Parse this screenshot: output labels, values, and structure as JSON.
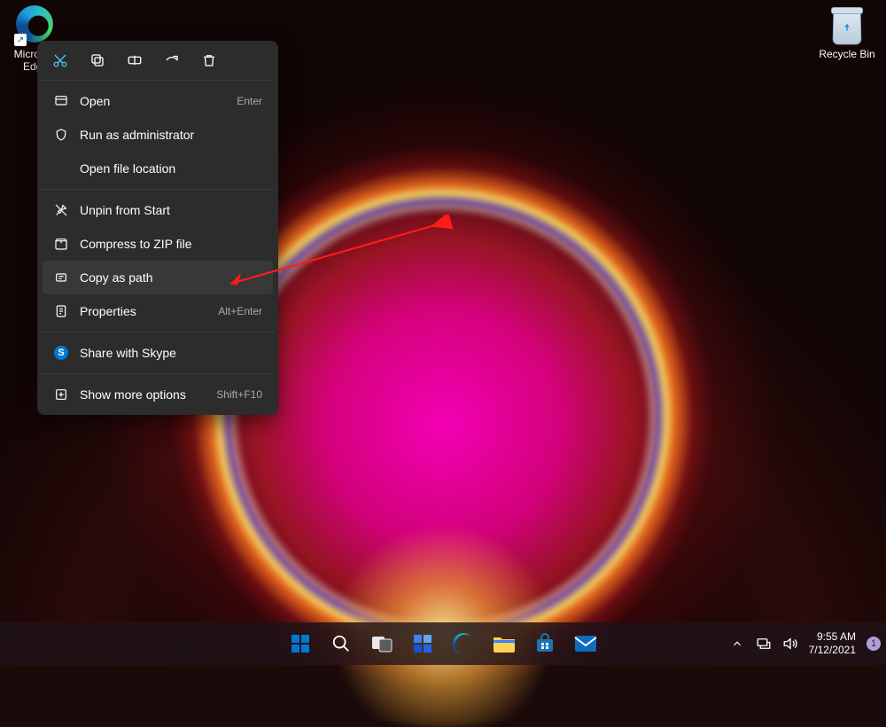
{
  "desktop": {
    "icons": {
      "edge_label": "Microsoft Edge",
      "recycle_label": "Recycle Bin"
    }
  },
  "context_menu": {
    "toolbar_icons": [
      "cut",
      "copy",
      "rename",
      "share",
      "delete"
    ],
    "items": [
      {
        "icon": "open",
        "label": "Open",
        "accel": "Enter"
      },
      {
        "icon": "shield",
        "label": "Run as administrator",
        "accel": ""
      },
      {
        "icon": "",
        "label": "Open file location",
        "accel": ""
      },
      {
        "sep": true
      },
      {
        "icon": "unpin",
        "label": "Unpin from Start",
        "accel": ""
      },
      {
        "icon": "zip",
        "label": "Compress to ZIP file",
        "accel": ""
      },
      {
        "icon": "copypath",
        "label": "Copy as path",
        "accel": "",
        "hovered": true
      },
      {
        "icon": "properties",
        "label": "Properties",
        "accel": "Alt+Enter"
      },
      {
        "sep": true
      },
      {
        "icon": "skype",
        "label": "Share with Skype",
        "accel": ""
      },
      {
        "sep": true
      },
      {
        "icon": "more",
        "label": "Show more options",
        "accel": "Shift+F10"
      }
    ]
  },
  "taskbar": {
    "icons": [
      "start",
      "search",
      "taskview",
      "widgets",
      "edge",
      "explorer",
      "store",
      "mail"
    ]
  },
  "tray": {
    "chevron": "^",
    "time": "9:55 AM",
    "date": "7/12/2021",
    "notif_count": "1"
  }
}
